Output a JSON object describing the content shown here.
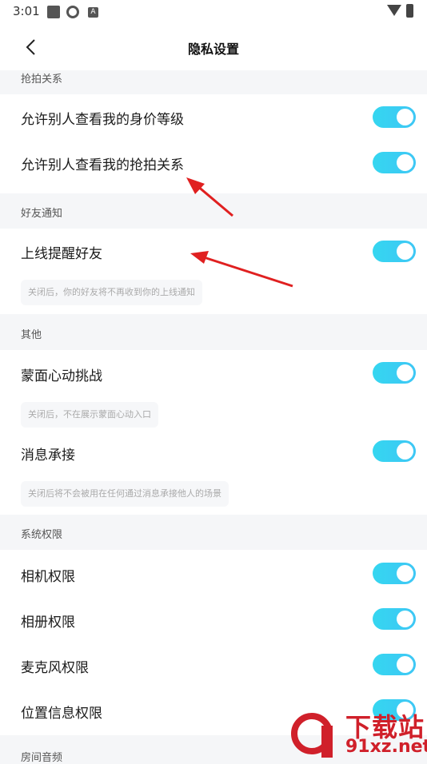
{
  "status_bar": {
    "time": "3:01",
    "notif_icon_letter": "A"
  },
  "header": {
    "title": "隐私设置"
  },
  "sections": [
    {
      "label": "抢拍关系"
    },
    {
      "label": "好友通知"
    },
    {
      "label": "其他"
    },
    {
      "label": "系统权限"
    },
    {
      "label": "房间音频"
    }
  ],
  "rows": {
    "allow_view_level": {
      "label": "允许别人查看我的身价等级",
      "on": true
    },
    "allow_view_relation": {
      "label": "允许别人查看我的抢拍关系",
      "on": true
    },
    "online_notify": {
      "label": "上线提醒好友",
      "on": true,
      "hint": "关闭后，你的好友将不再收到你的上线通知"
    },
    "mask_challenge": {
      "label": "蒙面心动挑战",
      "on": true,
      "hint": "关闭后，不在展示蒙面心动入口"
    },
    "message_accept": {
      "label": "消息承接",
      "on": true,
      "hint": "关闭后将不会被用在任何通过消息承接他人的场景"
    },
    "camera_perm": {
      "label": "相机权限",
      "on": true
    },
    "album_perm": {
      "label": "相册权限",
      "on": true
    },
    "mic_perm": {
      "label": "麦克风权限",
      "on": true
    },
    "location_perm": {
      "label": "位置信息权限",
      "on": true
    }
  },
  "watermark": {
    "line1": "下载站",
    "line2": "91xz.net"
  },
  "colors": {
    "toggle_on": "#35d6f0",
    "arrow": "#e02020",
    "background": "#f5f6f8"
  }
}
